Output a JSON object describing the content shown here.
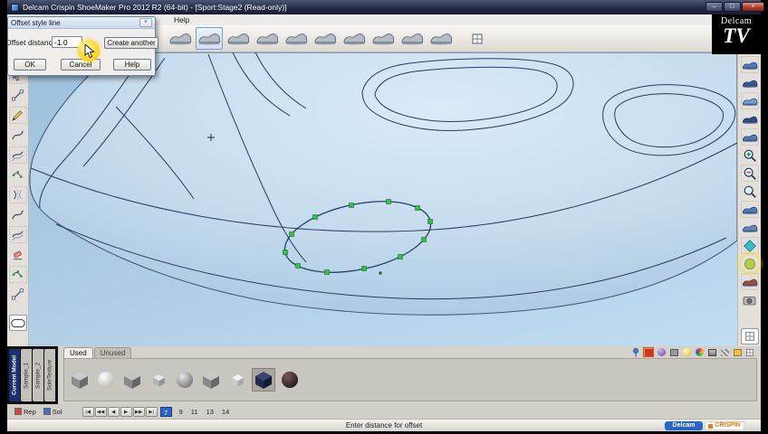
{
  "window": {
    "title": "Delcam Crispin ShoeMaker Pro 2012 R2 (64-bit) - [Sport:Stage2 (Read-only)]",
    "minimize_glyph": "–",
    "maximize_glyph": "□",
    "close_glyph": "×"
  },
  "watermark": {
    "brand": "Delcam",
    "tv": "TV"
  },
  "menubar": {
    "help": "Help"
  },
  "toolbar": {
    "icons": [
      "shoe-last-icon",
      "shoe-upper-icon",
      "shoe-flatten-icon",
      "style-lines-icon",
      "shoe-trim-icon",
      "shoe-punch-icon",
      "shoe-stitch-icon",
      "shoe-accessories-icon",
      "shoe-sole-icon",
      "shoe-grade-icon",
      "measure-icon"
    ]
  },
  "dialog": {
    "title": "Offset style line",
    "close_glyph": "×",
    "field_label": "Offset distance",
    "field_value": "-1.0",
    "create_another": "Create another",
    "ok": "OK",
    "cancel": "Cancel",
    "help": "Help"
  },
  "left_toolbar": {
    "icons": [
      "select-icon",
      "draw-line-icon",
      "draw-pencil-icon",
      "edit-curve-icon",
      "offset-curve-icon",
      "curve-points-icon",
      "mirror-curve-icon",
      "smooth-curve-icon",
      "project-curve-icon",
      "delete-curve-icon",
      "join-curve-icon",
      "split-line-icon",
      "loop-region-icon"
    ]
  },
  "right_toolbar": {
    "icons": [
      "view-last-icon",
      "view-shoe-top-icon",
      "view-shoe-side-icon",
      "view-shoe-back-icon",
      "view-shoe-3q-icon",
      "zoom-in-icon",
      "zoom-out-icon",
      "zoom-fit-icon",
      "rotate-view-icon",
      "pan-view-icon",
      "render-wireframe-icon",
      "render-shaded-icon",
      "render-texture-icon",
      "snapshot-icon",
      "panel-toggle-icon"
    ]
  },
  "materials": {
    "used_tab": "Used",
    "unused_tab": "Unused",
    "model_tabs": [
      "Current Model",
      "Sample_1",
      "Sample_2",
      "SoleTexture"
    ],
    "swatches": [
      "gray-cube",
      "white-sphere",
      "gray-cube",
      "light-cube",
      "gray-sphere",
      "gray-cube",
      "white-cube",
      "navy-cube",
      "dark-sphere"
    ],
    "panel_icons": [
      "pin-icon",
      "apply-material-icon",
      "sphere-preview-icon",
      "lock-icon",
      "bulb-icon",
      "color-wheel-icon",
      "paint-bucket-icon",
      "texture-icon",
      "folder-icon",
      "grid-icon"
    ]
  },
  "framebar": {
    "rep_label": "Rep",
    "sol_label": "Sol",
    "arrows": [
      "|◀",
      "◀◀",
      "◀",
      "▶",
      "▶▶",
      "▶|"
    ],
    "current_page": "7",
    "pages": [
      "9",
      "11",
      "13",
      "14"
    ]
  },
  "statusbar": {
    "message": "Enter distance for offset",
    "delcam_logo": "Delcam",
    "crispin_logo": "CRISPIN"
  },
  "colors": {
    "accent_blue": "#2a66c8",
    "highlight_yellow": "#ffd21e",
    "crispin_orange": "#e87c1e",
    "canvas_blue": "#abcbe4",
    "selection_green": "#35c24a"
  }
}
